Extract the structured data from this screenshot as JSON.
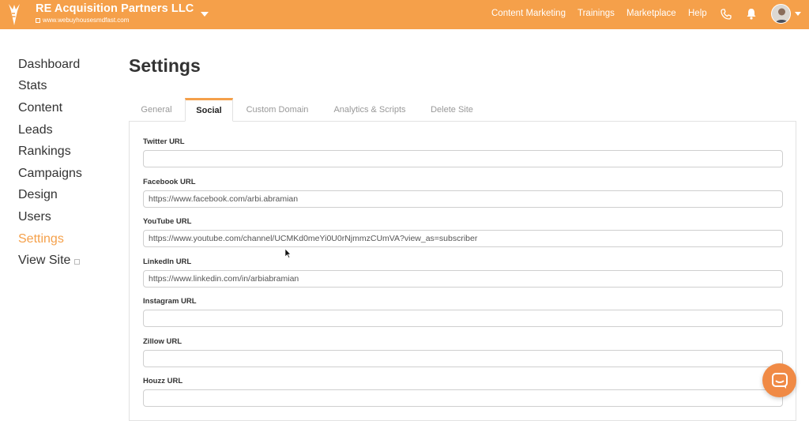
{
  "header": {
    "site_name": "RE Acquisition Partners LLC",
    "site_url": "www.webuyhousesmdfast.com",
    "nav": [
      "Content Marketing",
      "Trainings",
      "Marketplace",
      "Help"
    ],
    "icons": [
      "carrot-logo-icon",
      "phone-icon",
      "bell-icon",
      "avatar",
      "chevron-down-icon"
    ],
    "brand_color": "#f5a04a"
  },
  "sidebar": {
    "items": [
      {
        "label": "Dashboard"
      },
      {
        "label": "Stats"
      },
      {
        "label": "Content"
      },
      {
        "label": "Leads"
      },
      {
        "label": "Rankings"
      },
      {
        "label": "Campaigns"
      },
      {
        "label": "Design"
      },
      {
        "label": "Users"
      },
      {
        "label": "Settings",
        "active": true
      },
      {
        "label": "View Site",
        "external": true
      }
    ]
  },
  "page": {
    "title": "Settings",
    "tabs": [
      {
        "label": "General"
      },
      {
        "label": "Social",
        "active": true
      },
      {
        "label": "Custom Domain"
      },
      {
        "label": "Analytics & Scripts"
      },
      {
        "label": "Delete Site"
      }
    ],
    "fields": [
      {
        "label": "Twitter URL",
        "value": ""
      },
      {
        "label": "Facebook URL",
        "value": "https://www.facebook.com/arbi.abramian"
      },
      {
        "label": "YouTube URL",
        "value": "https://www.youtube.com/channel/UCMKd0meYi0U0rNjmmzCUmVA?view_as=subscriber"
      },
      {
        "label": "LinkedIn URL",
        "value": "https://www.linkedin.com/in/arbiabramian"
      },
      {
        "label": "Instagram URL",
        "value": ""
      },
      {
        "label": "Zillow URL",
        "value": ""
      },
      {
        "label": "Houzz URL",
        "value": ""
      }
    ]
  },
  "chat": {
    "icon": "chat-bubble-icon",
    "color": "#f08a45"
  }
}
